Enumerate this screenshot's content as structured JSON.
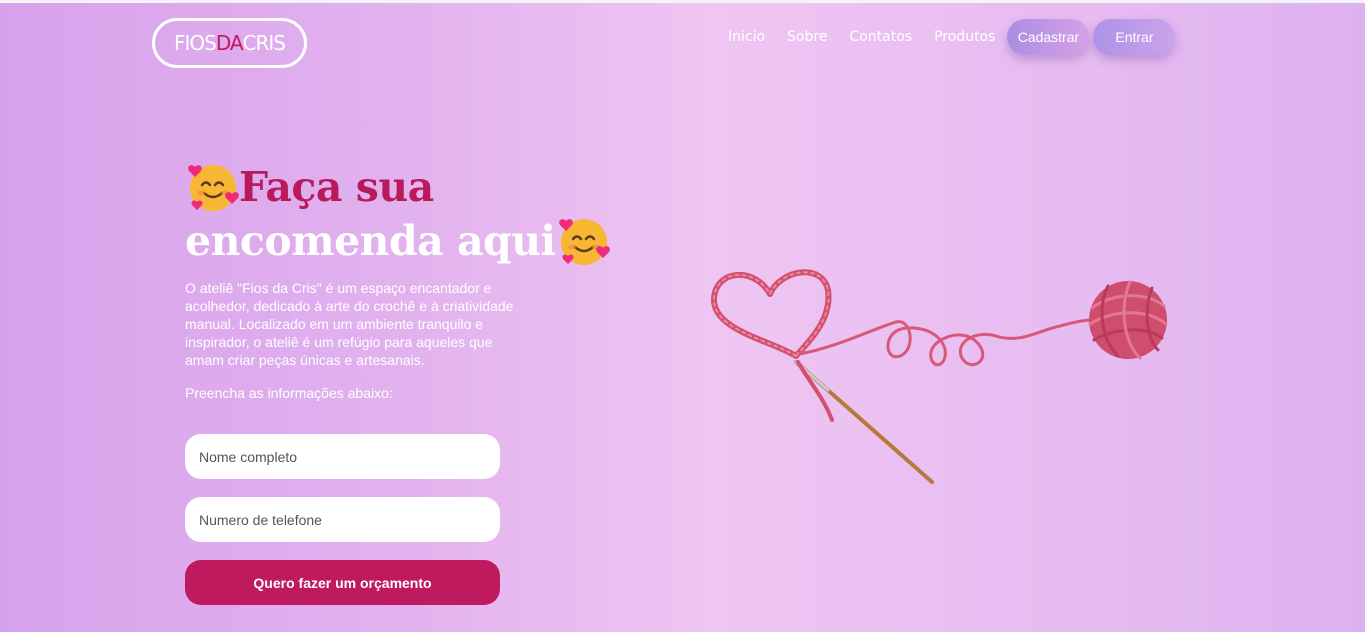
{
  "header": {
    "logo_part1": "FIOS",
    "logo_part2": "DA",
    "logo_part3": "CRIS",
    "nav": [
      "Inicio",
      "Sobre",
      "Contatos",
      "Produtos"
    ],
    "signup_label": "Cadastrar",
    "login_label": "Entrar"
  },
  "hero": {
    "title_line1": "Faça sua",
    "title_line2": "encomenda aqui",
    "emoji_icon": "smiling-face-with-hearts-icon",
    "description": "O ateliê \"Fios da Cris\" é um espaço encantador e acolhedor, dedicado à arte do crochê e à criatividade manual. Localizado em um ambiente tranquilo e inspirador, o ateliê é um refúgio para aqueles que amam criar peças únicas e artesanais.",
    "instructions": "Preencha as informações abaixo:"
  },
  "form": {
    "name_placeholder": "Nome completo",
    "phone_placeholder": "Numero de telefone",
    "submit_label": "Quero fazer um orçamento"
  },
  "illustration": {
    "icon": "yarn-heart-crochet-hook-icon"
  },
  "colors": {
    "accent": "#c01a5e",
    "title_pink": "#b81a5c",
    "pill": "#b898e8",
    "background": "#e6b8f0"
  }
}
